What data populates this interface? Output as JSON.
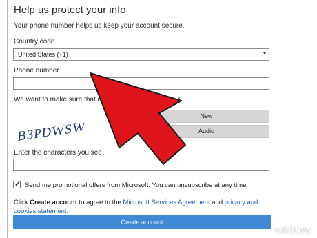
{
  "header": {
    "title": "Help us protect your info",
    "subtitle": "Your phone number helps us keep your account secure."
  },
  "country": {
    "label": "Country code",
    "value": "United States (+1)"
  },
  "phone": {
    "label": "Phone number",
    "value": ""
  },
  "verify": {
    "text_start": "We want to make sure that a real",
    "text_end": "r."
  },
  "captcha": {
    "text": "B3PDWSW",
    "new_label": "New",
    "audio_label": "Audio",
    "enter_label": "Enter the characters you see",
    "value": ""
  },
  "promo": {
    "checked": true,
    "label": "Send me promotional offers from Microsoft. You can unsubscribe at any time."
  },
  "terms": {
    "prefix": "Click ",
    "create_bold": "Create account",
    "middle": " to agree to the ",
    "msa_link": "Microsoft Services Agreement",
    "and": " and ",
    "privacy_link": "privacy and cookies statement",
    "suffix": "."
  },
  "create_button": "Create account",
  "watermark": {
    "wiki": "wiki",
    "how": "How"
  },
  "colors": {
    "arrow": "#e0151c",
    "button_blue": "#3f89d6",
    "link": "#1f5fb0"
  }
}
